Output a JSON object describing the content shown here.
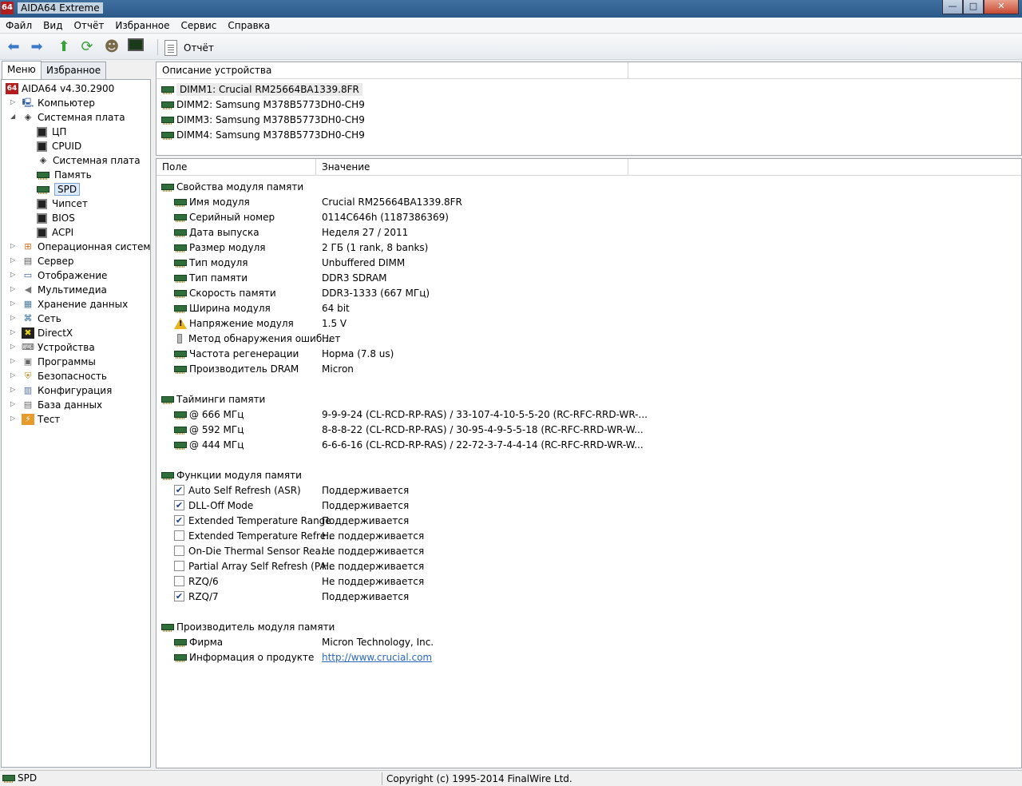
{
  "window": {
    "title": "AIDA64 Extreme",
    "icon_text": "64",
    "minimize": "—",
    "maximize": "□",
    "close": "✕"
  },
  "menubar": [
    "Файл",
    "Вид",
    "Отчёт",
    "Избранное",
    "Сервис",
    "Справка"
  ],
  "toolbar": {
    "report_label": "Отчёт"
  },
  "left_tabs": {
    "menu": "Меню",
    "favorites": "Избранное"
  },
  "tree": [
    {
      "label": "AIDA64 v4.30.2900",
      "level": 0,
      "icon": "aida-icon"
    },
    {
      "label": "Компьютер",
      "level": 1,
      "icon": "computer-icon",
      "expander": "▷"
    },
    {
      "label": "Системная плата",
      "level": 1,
      "icon": "motherboard-icon",
      "expander": "◢"
    },
    {
      "label": "ЦП",
      "level": 2,
      "icon": "chip-icon"
    },
    {
      "label": "CPUID",
      "level": 2,
      "icon": "chip-icon"
    },
    {
      "label": "Системная плата",
      "level": 2,
      "icon": "motherboard-icon"
    },
    {
      "label": "Память",
      "level": 2,
      "icon": "ram-icon"
    },
    {
      "label": "SPD",
      "level": 2,
      "icon": "ram-icon",
      "selected": true
    },
    {
      "label": "Чипсет",
      "level": 2,
      "icon": "chip-icon"
    },
    {
      "label": "BIOS",
      "level": 2,
      "icon": "chip-icon"
    },
    {
      "label": "ACPI",
      "level": 2,
      "icon": "chip-icon"
    },
    {
      "label": "Операционная система",
      "level": 1,
      "icon": "windows-icon",
      "expander": "▷"
    },
    {
      "label": "Сервер",
      "level": 1,
      "icon": "server-icon",
      "expander": "▷"
    },
    {
      "label": "Отображение",
      "level": 1,
      "icon": "display-icon",
      "expander": "▷"
    },
    {
      "label": "Мультимедиа",
      "level": 1,
      "icon": "speaker-icon",
      "expander": "▷"
    },
    {
      "label": "Хранение данных",
      "level": 1,
      "icon": "storage-icon",
      "expander": "▷"
    },
    {
      "label": "Сеть",
      "level": 1,
      "icon": "network-icon",
      "expander": "▷"
    },
    {
      "label": "DirectX",
      "level": 1,
      "icon": "directx-icon",
      "expander": "▷"
    },
    {
      "label": "Устройства",
      "level": 1,
      "icon": "devices-icon",
      "expander": "▷"
    },
    {
      "label": "Программы",
      "level": 1,
      "icon": "programs-icon",
      "expander": "▷"
    },
    {
      "label": "Безопасность",
      "level": 1,
      "icon": "shield-icon",
      "expander": "▷"
    },
    {
      "label": "Конфигурация",
      "level": 1,
      "icon": "config-icon",
      "expander": "▷"
    },
    {
      "label": "База данных",
      "level": 1,
      "icon": "database-icon",
      "expander": "▷"
    },
    {
      "label": "Тест",
      "level": 1,
      "icon": "benchmark-icon",
      "expander": "▷"
    }
  ],
  "devices": {
    "header": "Описание устройства",
    "items": [
      "DIMM1: Crucial RM25664BA1339.8FR",
      "DIMM2: Samsung M378B5773DH0-CH9",
      "DIMM3: Samsung M378B5773DH0-CH9",
      "DIMM4: Samsung M378B5773DH0-CH9"
    ]
  },
  "details": {
    "headers": {
      "field": "Поле",
      "value": "Значение"
    },
    "sections": [
      {
        "title": "Свойства модуля памяти",
        "rows": [
          {
            "field": "Имя модуля",
            "value": "Crucial RM25664BA1339.8FR",
            "icon": "ram"
          },
          {
            "field": "Серийный номер",
            "value": "0114C646h (1187386369)",
            "icon": "ram"
          },
          {
            "field": "Дата выпуска",
            "value": "Неделя 27 / 2011",
            "icon": "ram"
          },
          {
            "field": "Размер модуля",
            "value": "2 ГБ (1 rank, 8 banks)",
            "icon": "ram"
          },
          {
            "field": "Тип модуля",
            "value": "Unbuffered DIMM",
            "icon": "ram"
          },
          {
            "field": "Тип памяти",
            "value": "DDR3 SDRAM",
            "icon": "ram"
          },
          {
            "field": "Скорость памяти",
            "value": "DDR3-1333 (667 МГц)",
            "icon": "ram"
          },
          {
            "field": "Ширина модуля",
            "value": "64 bit",
            "icon": "ram"
          },
          {
            "field": "Напряжение модуля",
            "value": "1.5 V",
            "icon": "warning"
          },
          {
            "field": "Метод обнаружения ошиб...",
            "value": "Нет",
            "icon": "small"
          },
          {
            "field": "Частота регенерации",
            "value": "Норма (7.8 us)",
            "icon": "ram"
          },
          {
            "field": "Производитель DRAM",
            "value": "Micron",
            "icon": "ram"
          }
        ]
      },
      {
        "title": "Тайминги памяти",
        "rows": [
          {
            "field": "@ 666 МГц",
            "value": "9-9-9-24  (CL-RCD-RP-RAS) / 33-107-4-10-5-5-20  (RC-RFC-RRD-WR-...",
            "icon": "ram"
          },
          {
            "field": "@ 592 МГц",
            "value": "8-8-8-22  (CL-RCD-RP-RAS) / 30-95-4-9-5-5-18  (RC-RFC-RRD-WR-W...",
            "icon": "ram"
          },
          {
            "field": "@ 444 МГц",
            "value": "6-6-6-16  (CL-RCD-RP-RAS) / 22-72-3-7-4-4-14  (RC-RFC-RRD-WR-W...",
            "icon": "ram"
          }
        ]
      },
      {
        "title": "Функции модуля памяти",
        "rows": [
          {
            "field": "Auto Self Refresh (ASR)",
            "value": "Поддерживается",
            "icon": "checked"
          },
          {
            "field": "DLL-Off Mode",
            "value": "Поддерживается",
            "icon": "checked"
          },
          {
            "field": "Extended Temperature Range",
            "value": "Поддерживается",
            "icon": "checked"
          },
          {
            "field": "Extended Temperature Refre...",
            "value": "Не поддерживается",
            "icon": "unchecked"
          },
          {
            "field": "On-Die Thermal Sensor Rea...",
            "value": "Не поддерживается",
            "icon": "unchecked"
          },
          {
            "field": "Partial Array Self Refresh (PA...",
            "value": "Не поддерживается",
            "icon": "unchecked"
          },
          {
            "field": "RZQ/6",
            "value": "Не поддерживается",
            "icon": "unchecked"
          },
          {
            "field": "RZQ/7",
            "value": "Поддерживается",
            "icon": "checked"
          }
        ]
      },
      {
        "title": "Производитель модуля памяти",
        "rows": [
          {
            "field": "Фирма",
            "value": "Micron Technology, Inc.",
            "icon": "ram"
          },
          {
            "field": "Информация о продукте",
            "value": "http://www.crucial.com",
            "icon": "ram",
            "link": true
          }
        ]
      }
    ]
  },
  "statusbar": {
    "left": "SPD",
    "right": "Copyright (c) 1995-2014 FinalWire Ltd."
  }
}
